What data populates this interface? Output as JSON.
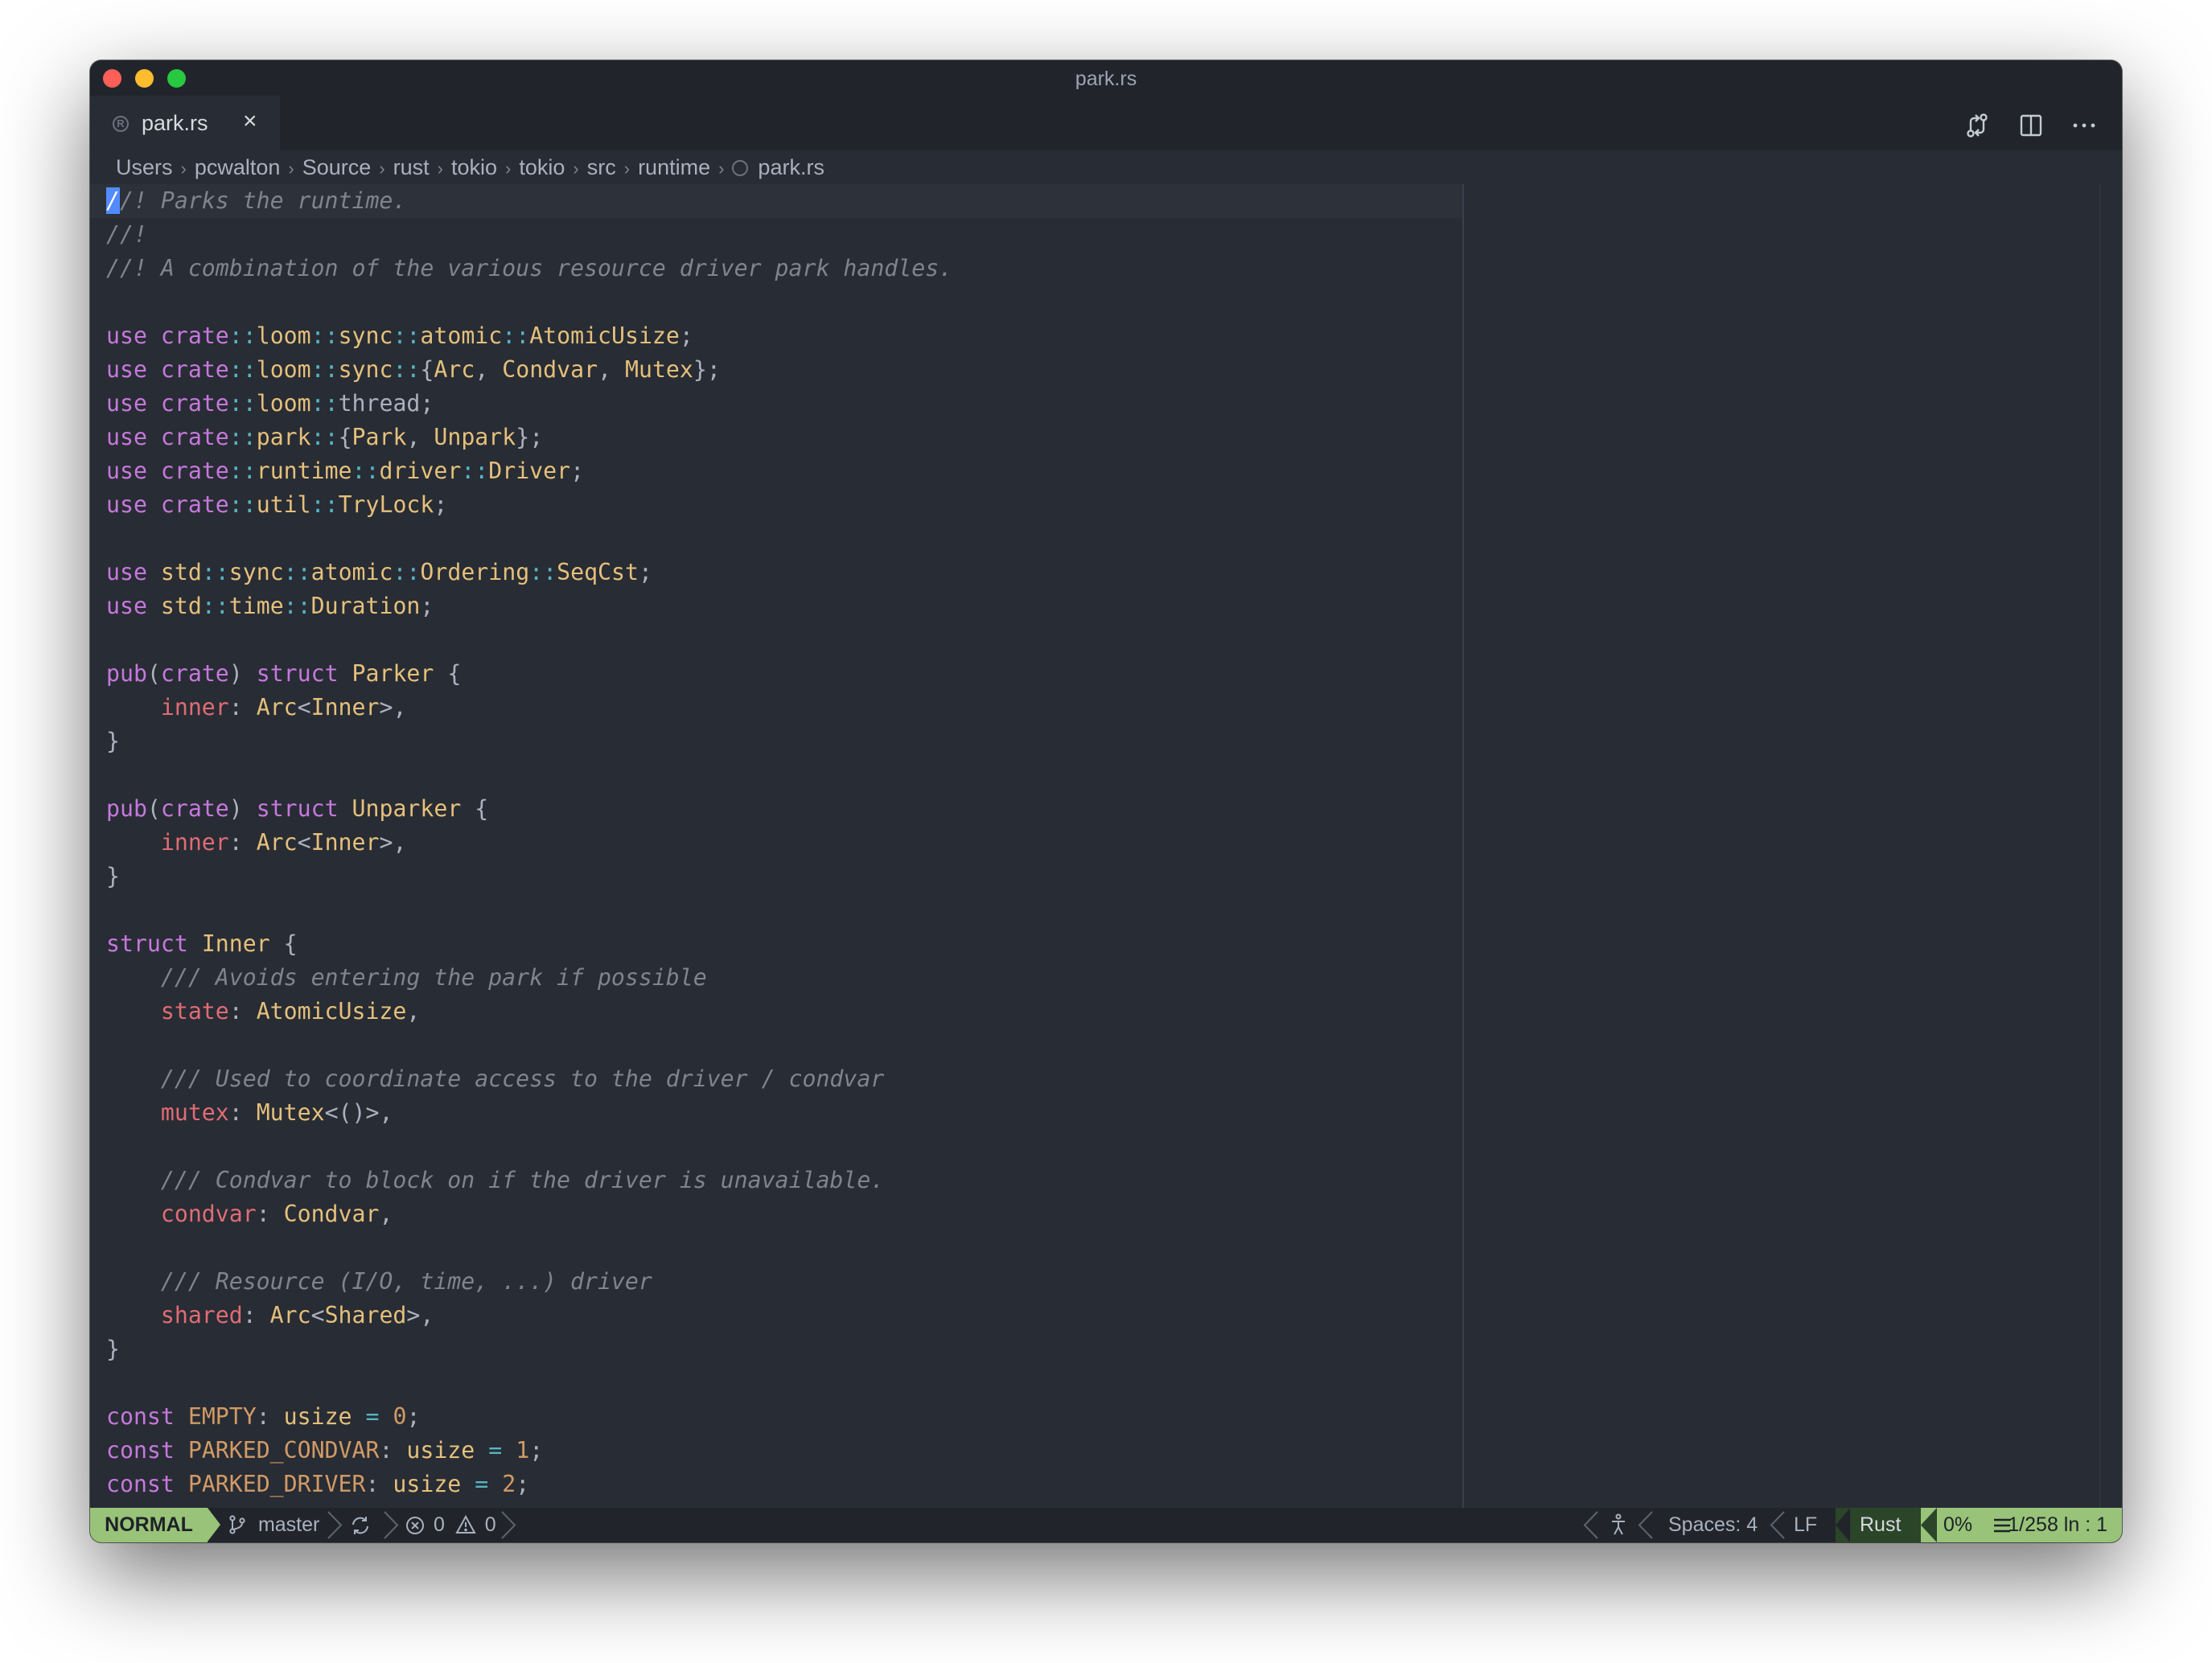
{
  "window": {
    "title": "park.rs"
  },
  "tabs": [
    {
      "label": "park.rs",
      "close_glyph": "×"
    }
  ],
  "toolbar": {
    "icons": [
      "source-control-compare-icon",
      "split-editor-icon",
      "more-actions-icon"
    ]
  },
  "breadcrumb": [
    "Users",
    "pcwalton",
    "Source",
    "rust",
    "tokio",
    "tokio",
    "src",
    "runtime",
    "park.rs"
  ],
  "editor": {
    "language": "rust",
    "lines": [
      [
        [
          "cursor",
          "/"
        ],
        [
          "cm",
          "/! Parks the runtime."
        ]
      ],
      [
        [
          "cm",
          "//!"
        ]
      ],
      [
        [
          "cm",
          "//! A combination of the various resource driver park handles."
        ]
      ],
      [],
      [
        [
          "kw",
          "use"
        ],
        [
          "pc",
          " "
        ],
        [
          "kw",
          "crate"
        ],
        [
          "op",
          "::"
        ],
        [
          "ty",
          "loom"
        ],
        [
          "op",
          "::"
        ],
        [
          "ty",
          "sync"
        ],
        [
          "op",
          "::"
        ],
        [
          "ty",
          "atomic"
        ],
        [
          "op",
          "::"
        ],
        [
          "ty",
          "AtomicUsize"
        ],
        [
          "pc",
          ";"
        ]
      ],
      [
        [
          "kw",
          "use"
        ],
        [
          "pc",
          " "
        ],
        [
          "kw",
          "crate"
        ],
        [
          "op",
          "::"
        ],
        [
          "ty",
          "loom"
        ],
        [
          "op",
          "::"
        ],
        [
          "ty",
          "sync"
        ],
        [
          "op",
          "::"
        ],
        [
          "pc",
          "{"
        ],
        [
          "ty",
          "Arc"
        ],
        [
          "pc",
          ", "
        ],
        [
          "ty",
          "Condvar"
        ],
        [
          "pc",
          ", "
        ],
        [
          "ty",
          "Mutex"
        ],
        [
          "pc",
          "};"
        ]
      ],
      [
        [
          "kw",
          "use"
        ],
        [
          "pc",
          " "
        ],
        [
          "kw",
          "crate"
        ],
        [
          "op",
          "::"
        ],
        [
          "ty",
          "loom"
        ],
        [
          "op",
          "::"
        ],
        [
          "pc",
          "thread;"
        ]
      ],
      [
        [
          "kw",
          "use"
        ],
        [
          "pc",
          " "
        ],
        [
          "kw",
          "crate"
        ],
        [
          "op",
          "::"
        ],
        [
          "ty",
          "park"
        ],
        [
          "op",
          "::"
        ],
        [
          "pc",
          "{"
        ],
        [
          "ty",
          "Park"
        ],
        [
          "pc",
          ", "
        ],
        [
          "ty",
          "Unpark"
        ],
        [
          "pc",
          "};"
        ]
      ],
      [
        [
          "kw",
          "use"
        ],
        [
          "pc",
          " "
        ],
        [
          "kw",
          "crate"
        ],
        [
          "op",
          "::"
        ],
        [
          "ty",
          "runtime"
        ],
        [
          "op",
          "::"
        ],
        [
          "ty",
          "driver"
        ],
        [
          "op",
          "::"
        ],
        [
          "ty",
          "Driver"
        ],
        [
          "pc",
          ";"
        ]
      ],
      [
        [
          "kw",
          "use"
        ],
        [
          "pc",
          " "
        ],
        [
          "kw",
          "crate"
        ],
        [
          "op",
          "::"
        ],
        [
          "ty",
          "util"
        ],
        [
          "op",
          "::"
        ],
        [
          "ty",
          "TryLock"
        ],
        [
          "pc",
          ";"
        ]
      ],
      [],
      [
        [
          "kw",
          "use"
        ],
        [
          "pc",
          " "
        ],
        [
          "ty",
          "std"
        ],
        [
          "op",
          "::"
        ],
        [
          "ty",
          "sync"
        ],
        [
          "op",
          "::"
        ],
        [
          "ty",
          "atomic"
        ],
        [
          "op",
          "::"
        ],
        [
          "ty",
          "Ordering"
        ],
        [
          "op",
          "::"
        ],
        [
          "ty",
          "SeqCst"
        ],
        [
          "pc",
          ";"
        ]
      ],
      [
        [
          "kw",
          "use"
        ],
        [
          "pc",
          " "
        ],
        [
          "ty",
          "std"
        ],
        [
          "op",
          "::"
        ],
        [
          "ty",
          "time"
        ],
        [
          "op",
          "::"
        ],
        [
          "ty",
          "Duration"
        ],
        [
          "pc",
          ";"
        ]
      ],
      [],
      [
        [
          "kw",
          "pub"
        ],
        [
          "pc",
          "("
        ],
        [
          "kw",
          "crate"
        ],
        [
          "pc",
          ") "
        ],
        [
          "kw",
          "struct"
        ],
        [
          "pc",
          " "
        ],
        [
          "ty",
          "Parker"
        ],
        [
          "pc",
          " {"
        ]
      ],
      [
        [
          "pc",
          "    "
        ],
        [
          "fd",
          "inner"
        ],
        [
          "pc",
          ": "
        ],
        [
          "ty",
          "Arc"
        ],
        [
          "pc",
          "<"
        ],
        [
          "ty",
          "Inner"
        ],
        [
          "pc",
          ">,"
        ]
      ],
      [
        [
          "pc",
          "}"
        ]
      ],
      [],
      [
        [
          "kw",
          "pub"
        ],
        [
          "pc",
          "("
        ],
        [
          "kw",
          "crate"
        ],
        [
          "pc",
          ") "
        ],
        [
          "kw",
          "struct"
        ],
        [
          "pc",
          " "
        ],
        [
          "ty",
          "Unparker"
        ],
        [
          "pc",
          " {"
        ]
      ],
      [
        [
          "pc",
          "    "
        ],
        [
          "fd",
          "inner"
        ],
        [
          "pc",
          ": "
        ],
        [
          "ty",
          "Arc"
        ],
        [
          "pc",
          "<"
        ],
        [
          "ty",
          "Inner"
        ],
        [
          "pc",
          ">,"
        ]
      ],
      [
        [
          "pc",
          "}"
        ]
      ],
      [],
      [
        [
          "kw",
          "struct"
        ],
        [
          "pc",
          " "
        ],
        [
          "ty",
          "Inner"
        ],
        [
          "pc",
          " {"
        ]
      ],
      [
        [
          "pc",
          "    "
        ],
        [
          "cm",
          "/// Avoids entering the park if possible"
        ]
      ],
      [
        [
          "pc",
          "    "
        ],
        [
          "fd",
          "state"
        ],
        [
          "pc",
          ": "
        ],
        [
          "ty",
          "AtomicUsize"
        ],
        [
          "pc",
          ","
        ]
      ],
      [],
      [
        [
          "pc",
          "    "
        ],
        [
          "cm",
          "/// Used to coordinate access to the driver / condvar"
        ]
      ],
      [
        [
          "pc",
          "    "
        ],
        [
          "fd",
          "mutex"
        ],
        [
          "pc",
          ": "
        ],
        [
          "ty",
          "Mutex"
        ],
        [
          "pc",
          "<()>,"
        ]
      ],
      [],
      [
        [
          "pc",
          "    "
        ],
        [
          "cm",
          "/// Condvar to block on if the driver is unavailable."
        ]
      ],
      [
        [
          "pc",
          "    "
        ],
        [
          "fd",
          "condvar"
        ],
        [
          "pc",
          ": "
        ],
        [
          "ty",
          "Condvar"
        ],
        [
          "pc",
          ","
        ]
      ],
      [],
      [
        [
          "pc",
          "    "
        ],
        [
          "cm",
          "/// Resource (I/O, time, ...) driver"
        ]
      ],
      [
        [
          "pc",
          "    "
        ],
        [
          "fd",
          "shared"
        ],
        [
          "pc",
          ": "
        ],
        [
          "ty",
          "Arc"
        ],
        [
          "pc",
          "<"
        ],
        [
          "ty",
          "Shared"
        ],
        [
          "pc",
          ">,"
        ]
      ],
      [
        [
          "pc",
          "}"
        ]
      ],
      [],
      [
        [
          "kw",
          "const"
        ],
        [
          "pc",
          " "
        ],
        [
          "nm",
          "EMPTY"
        ],
        [
          "pc",
          ": "
        ],
        [
          "ty",
          "usize"
        ],
        [
          "pc",
          " "
        ],
        [
          "op",
          "="
        ],
        [
          "pc",
          " "
        ],
        [
          "nm",
          "0"
        ],
        [
          "pc",
          ";"
        ]
      ],
      [
        [
          "kw",
          "const"
        ],
        [
          "pc",
          " "
        ],
        [
          "nm",
          "PARKED_CONDVAR"
        ],
        [
          "pc",
          ": "
        ],
        [
          "ty",
          "usize"
        ],
        [
          "pc",
          " "
        ],
        [
          "op",
          "="
        ],
        [
          "pc",
          " "
        ],
        [
          "nm",
          "1"
        ],
        [
          "pc",
          ";"
        ]
      ],
      [
        [
          "kw",
          "const"
        ],
        [
          "pc",
          " "
        ],
        [
          "nm",
          "PARKED_DRIVER"
        ],
        [
          "pc",
          ": "
        ],
        [
          "ty",
          "usize"
        ],
        [
          "pc",
          " "
        ],
        [
          "op",
          "="
        ],
        [
          "pc",
          " "
        ],
        [
          "nm",
          "2"
        ],
        [
          "pc",
          ";"
        ]
      ]
    ]
  },
  "statusbar": {
    "mode": "NORMAL",
    "branch": "master",
    "errors": "0",
    "warnings": "0",
    "spaces": "Spaces: 4",
    "eol": "LF",
    "language": "Rust",
    "progress": "0%",
    "position": "1/258 ln : 1"
  },
  "colors": {
    "background": "#282c34",
    "keyword": "#c678dd",
    "type": "#e5c07b",
    "field": "#e06c75",
    "number": "#d19a66",
    "comment": "#7f848e",
    "mode_badge": "#98c379",
    "cursor": "#528bff"
  }
}
